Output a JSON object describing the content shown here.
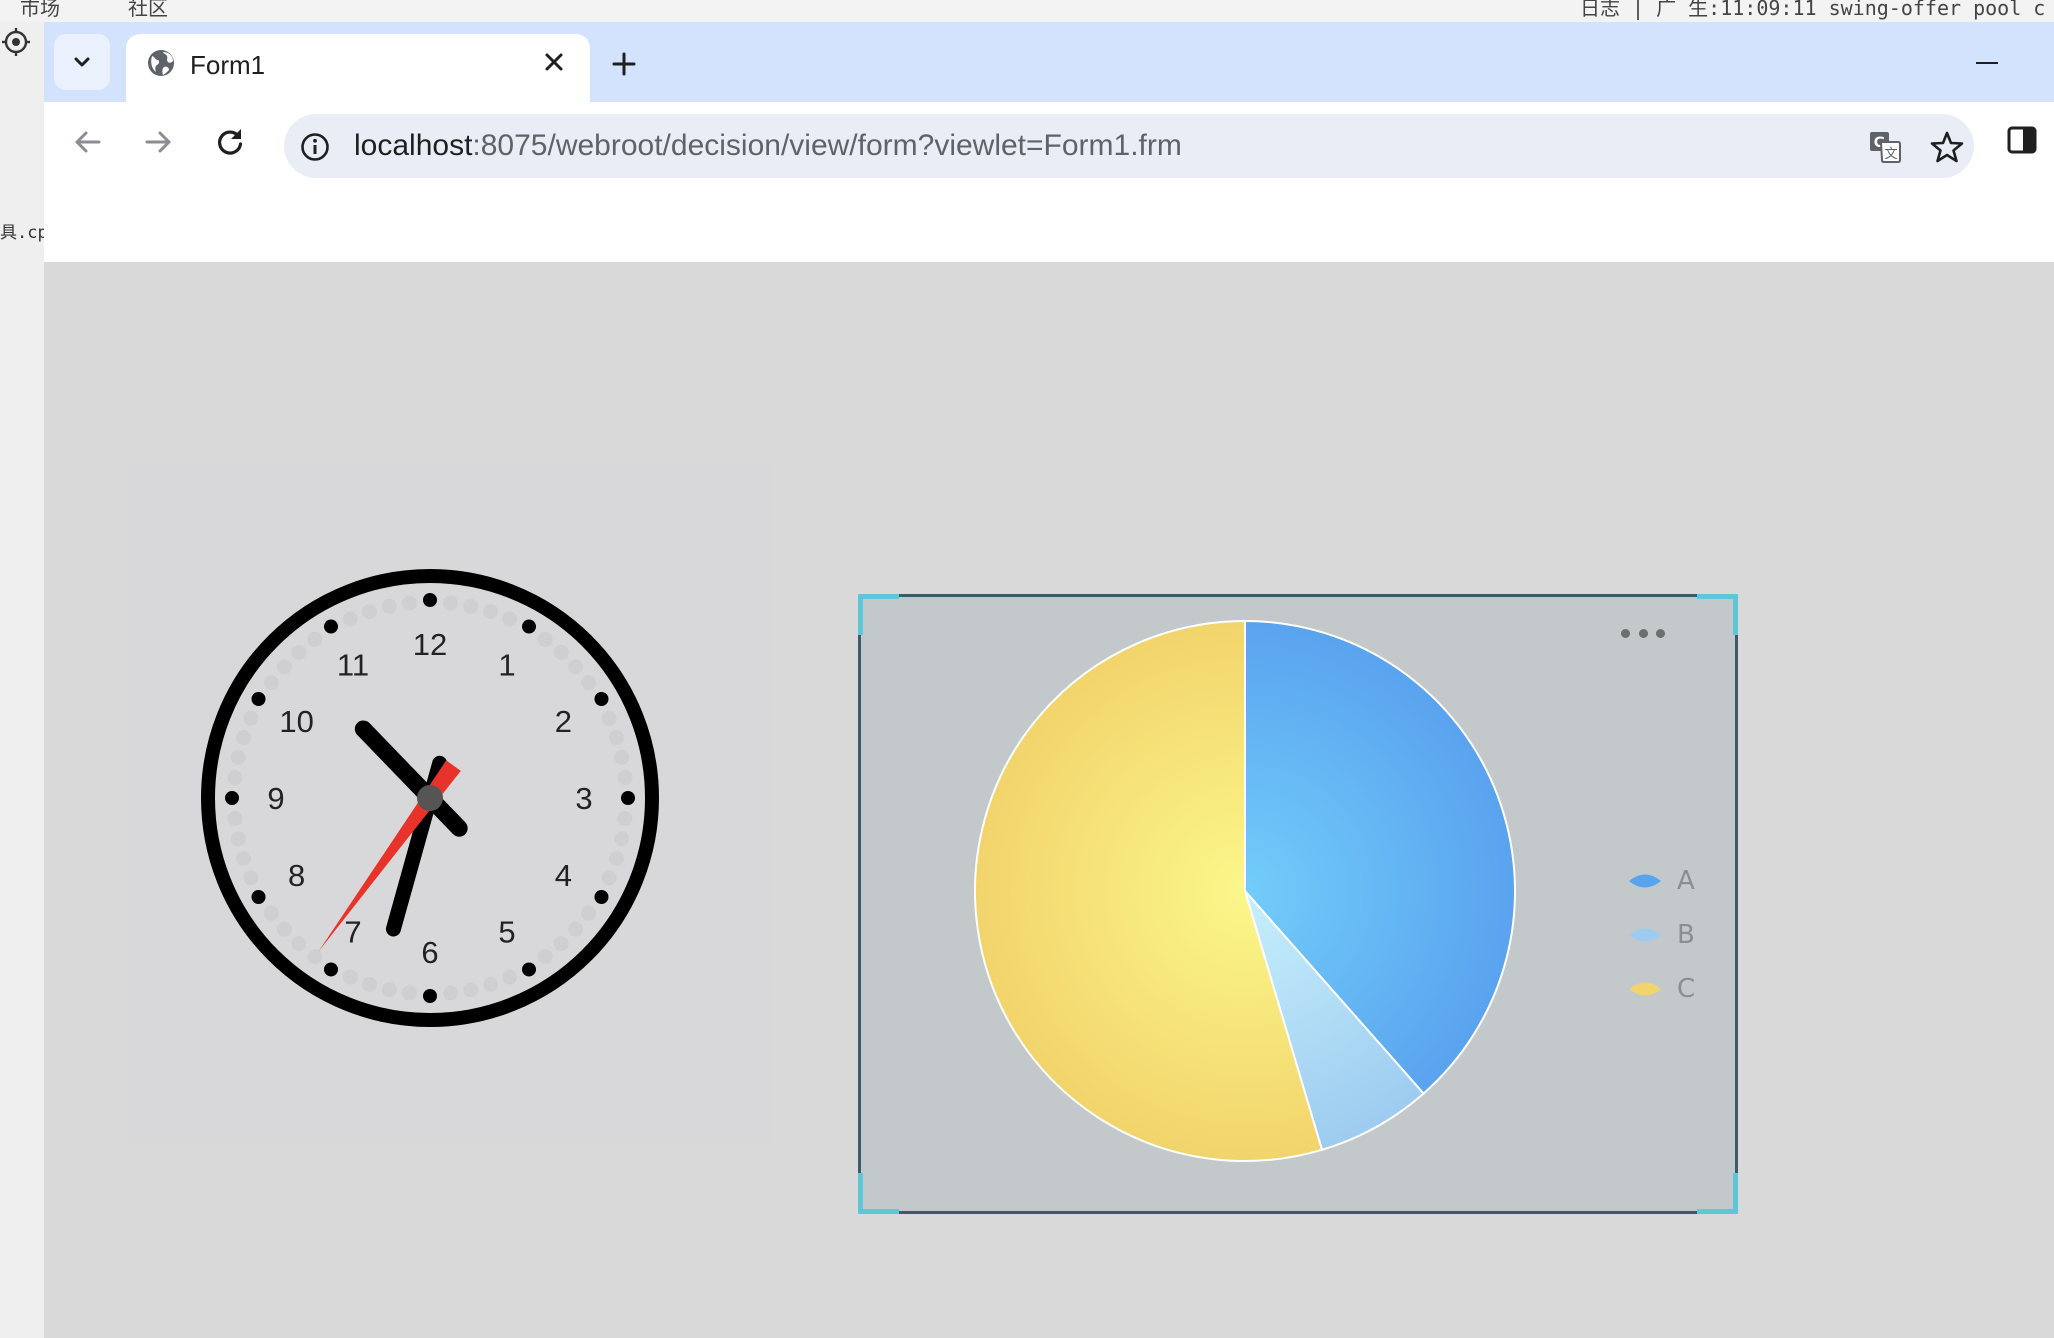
{
  "desktop": {
    "top_strip_texts": [
      "市场",
      "社区",
      "日志 | 广 生:11:09:11 swing-offer pool c"
    ],
    "left_cut_text": "具.cp"
  },
  "browser": {
    "tab": {
      "title": "Form1"
    },
    "icons": {
      "tab_list": "chevron-down-icon",
      "favicon": "globe-icon",
      "close": "close-icon",
      "new_tab": "plus-icon",
      "minimize": "minimize-icon",
      "back": "arrow-left-icon",
      "forward": "arrow-right-icon",
      "reload": "reload-icon",
      "site_info": "info-icon",
      "translate": "translate-icon",
      "bookmark": "star-icon",
      "side_panel": "side-panel-icon"
    },
    "address": {
      "host": "localhost",
      "path": ":8075/webroot/decision/view/form?viewlet=Form1.frm"
    }
  },
  "clock": {
    "numbers": [
      "12",
      "1",
      "2",
      "3",
      "4",
      "5",
      "6",
      "7",
      "8",
      "9",
      "10",
      "11"
    ],
    "time": {
      "hour": 10,
      "minute": 32,
      "second": 36
    },
    "colors": {
      "face": "#d8d8da",
      "rim": "#000000",
      "hands": "#000000",
      "second_hand": "#e8332a",
      "hub": "#555555"
    }
  },
  "chart_data": {
    "type": "pie",
    "series": [
      {
        "name": "A",
        "value": 38.5,
        "color": "#5aa3ef",
        "inner_color": "#72cdfa"
      },
      {
        "name": "B",
        "value": 6.9,
        "color": "#9dccf0",
        "inner_color": "#c7effc"
      },
      {
        "name": "C",
        "value": 54.6,
        "color": "#f2d46c",
        "inner_color": "#fbf78a"
      }
    ],
    "legend_position": "right",
    "legend": [
      "A",
      "B",
      "C"
    ]
  },
  "colors": {
    "tabbar": "#d3e3fd",
    "omnibox": "#e9eef6",
    "page_bg": "#d9d9d9",
    "chart_bg": "#c3c8ca",
    "chart_border": "#3c5a6a",
    "chart_corner": "#5fc6d8"
  }
}
